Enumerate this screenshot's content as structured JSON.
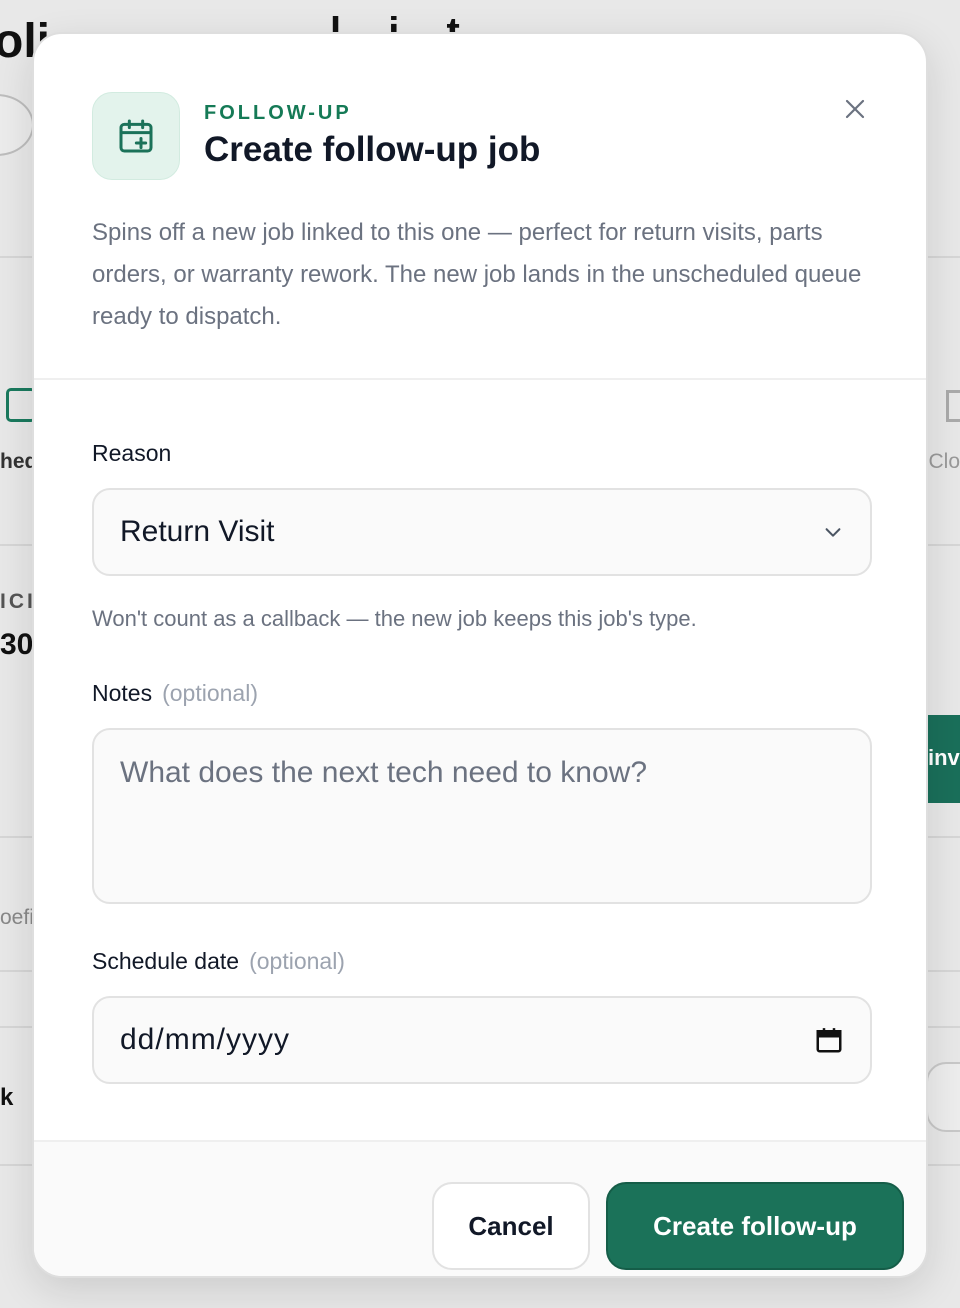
{
  "background": {
    "title_fragment": "oli",
    "title_fragment_2": "l i t",
    "left_label_1": "hed",
    "left_label_2": "ICI",
    "left_value": "30",
    "left_label_3": "oefi",
    "left_label_4": "k",
    "right_label_1": "Clo",
    "right_button_fragment": "inv"
  },
  "modal": {
    "eyebrow": "FOLLOW-UP",
    "title": "Create follow-up job",
    "description": "Spins off a new job linked to this one — perfect for return visits, parts orders, or warranty rework. The new job lands in the unscheduled queue ready to dispatch.",
    "reason": {
      "label": "Reason",
      "selected": "Return Visit",
      "hint": "Won't count as a callback — the new job keeps this job's type."
    },
    "notes": {
      "label": "Notes",
      "optional": "(optional)",
      "placeholder": "What does the next tech need to know?"
    },
    "schedule": {
      "label": "Schedule date",
      "optional": "(optional)",
      "value": "dd/mm/yyyy"
    },
    "footer": {
      "cancel_label": "Cancel",
      "create_label": "Create follow-up"
    }
  },
  "colors": {
    "accent": "#1b7259",
    "eyebrow": "#157a56",
    "icon_bg": "#e3f3ec"
  },
  "icons": {
    "header": "calendar-plus-icon",
    "close": "close-icon",
    "select": "chevron-down-icon",
    "date": "calendar-icon"
  }
}
